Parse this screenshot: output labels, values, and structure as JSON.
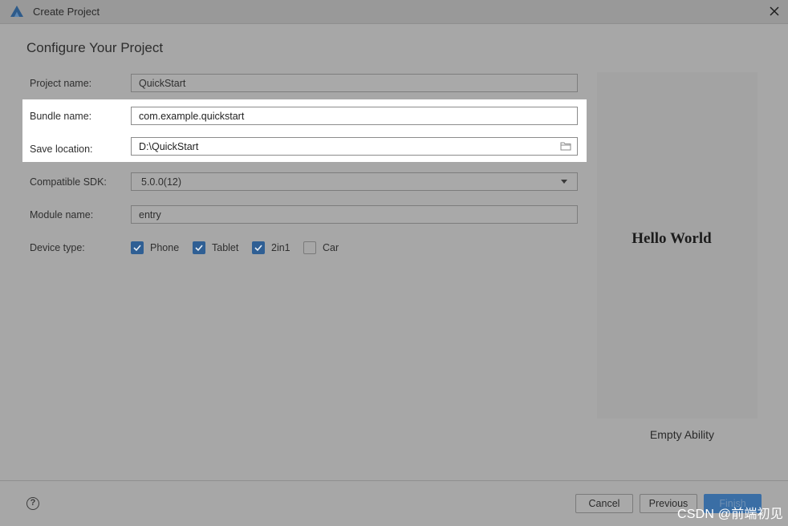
{
  "window": {
    "title": "Create Project"
  },
  "page": {
    "heading": "Configure Your Project"
  },
  "form": {
    "project_name": {
      "label": "Project name:",
      "value": "QuickStart"
    },
    "bundle_name": {
      "label": "Bundle name:",
      "value": "com.example.quickstart"
    },
    "save_location": {
      "label": "Save location:",
      "value": "D:\\QuickStart"
    },
    "compatible_sdk": {
      "label": "Compatible SDK:",
      "value": "5.0.0(12)"
    },
    "module_name": {
      "label": "Module name:",
      "value": "entry"
    },
    "device_type": {
      "label": "Device type:",
      "options": [
        {
          "label": "Phone",
          "checked": true
        },
        {
          "label": "Tablet",
          "checked": true
        },
        {
          "label": "2in1",
          "checked": true
        },
        {
          "label": "Car",
          "checked": false
        }
      ]
    }
  },
  "preview": {
    "text": "Hello World",
    "template_name": "Empty Ability"
  },
  "footer": {
    "help": "?",
    "cancel_label": "Cancel",
    "previous_label": "Previous",
    "finish_label": "Finish"
  },
  "watermark": "CSDN @前端初见",
  "colors": {
    "accent": "#2f5f94",
    "highlight": "#ffffff",
    "overlay": "#a7a7a7"
  },
  "icons": {
    "app": "deveco-logo-icon",
    "close": "close-icon",
    "folder": "folder-icon",
    "dropdown": "chevron-down-icon",
    "check": "checkmark-icon",
    "help": "help-icon"
  }
}
